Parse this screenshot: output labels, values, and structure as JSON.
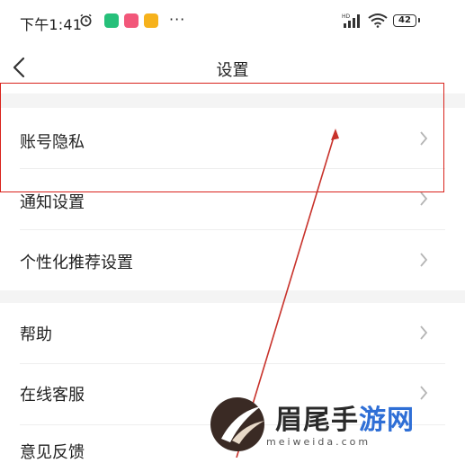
{
  "status_bar": {
    "time": "下午1:41",
    "battery": "42",
    "icons": [
      "alarm-icon",
      "app-icon-green",
      "app-icon-pink",
      "app-icon-yellow",
      "more-dots-icon",
      "hd-signal-icon",
      "wifi-icon",
      "battery-icon"
    ],
    "more": "···"
  },
  "nav": {
    "title": "设置",
    "back_icon": "chevron-left-icon"
  },
  "settings": {
    "group1": [
      {
        "label": "账号隐私"
      },
      {
        "label": "通知设置"
      },
      {
        "label": "个性化推荐设置"
      }
    ],
    "group2": [
      {
        "label": "帮助"
      },
      {
        "label": "在线客服"
      },
      {
        "label": "意见反馈"
      }
    ]
  },
  "annotation": {
    "highlight_color": "#d9231c",
    "arrow_color": "#c8322b"
  },
  "watermark": {
    "title_part1": "眉尾手",
    "title_part2": "游网",
    "subtitle": "meiweida.com"
  },
  "colors": {
    "background": "#ffffff",
    "section_gap": "#f4f4f4",
    "text": "#222222",
    "chevron": "#b5b5b5"
  }
}
